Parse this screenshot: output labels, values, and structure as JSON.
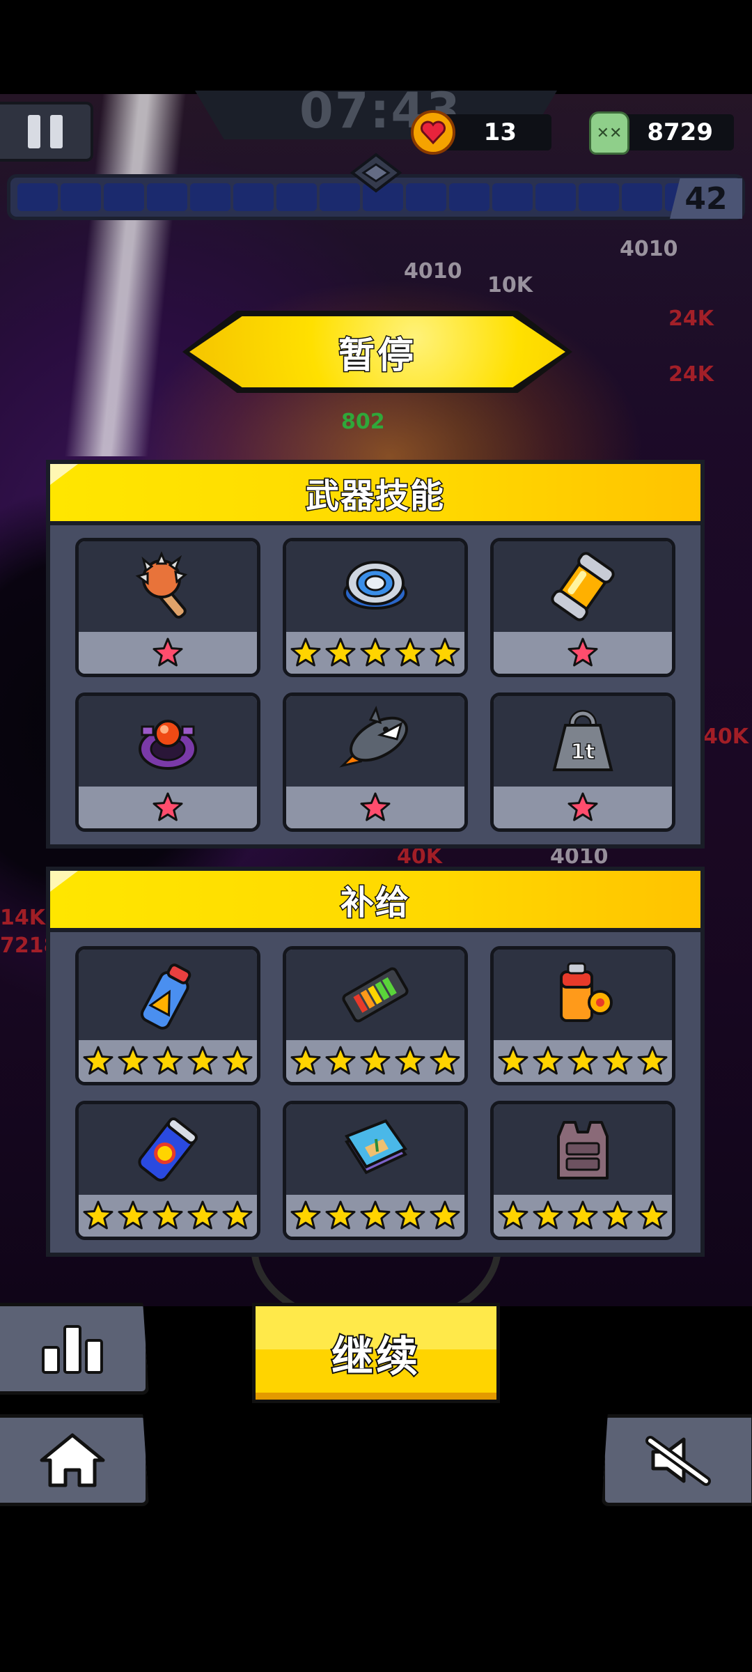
{
  "hud": {
    "timer": "07:43",
    "hearts": "13",
    "kills": "8729",
    "level": "42"
  },
  "pause_title": "暂停",
  "weapons_panel": {
    "title": "武器技能",
    "items": [
      {
        "icon": "spiked-club-icon",
        "stars": 1,
        "star_color": "#ff4d6d"
      },
      {
        "icon": "disc-drone-icon",
        "stars": 5,
        "star_color": "#ffd400"
      },
      {
        "icon": "energy-canister-icon",
        "stars": 1,
        "star_color": "#ff4d6d"
      },
      {
        "icon": "orb-turret-icon",
        "stars": 1,
        "star_color": "#ff4d6d"
      },
      {
        "icon": "shark-rocket-icon",
        "stars": 1,
        "star_color": "#ff4d6d"
      },
      {
        "icon": "one-ton-weight-icon",
        "stars": 1,
        "star_color": "#ff4d6d"
      }
    ],
    "weight_text": "1t"
  },
  "supplies_panel": {
    "title": "补给",
    "items": [
      {
        "icon": "spray-can-icon",
        "stars": 5,
        "star_color": "#ffd400"
      },
      {
        "icon": "battery-pack-icon",
        "stars": 5,
        "star_color": "#ffd400"
      },
      {
        "icon": "fuel-tank-icon",
        "stars": 5,
        "star_color": "#ffd400"
      },
      {
        "icon": "energy-drink-icon",
        "stars": 5,
        "star_color": "#ffd400"
      },
      {
        "icon": "map-book-icon",
        "stars": 5,
        "star_color": "#ffd400"
      },
      {
        "icon": "armor-vest-icon",
        "stars": 5,
        "star_color": "#ffd400"
      }
    ]
  },
  "continue_label": "继续",
  "buttons": {
    "stats": "bar-chart-icon",
    "home": "home-icon",
    "sound": "speaker-muted-icon"
  },
  "background_numbers": [
    "4010",
    "4010",
    "24K",
    "24K",
    "40K",
    "10K",
    "802",
    "7218",
    "14K",
    "40K",
    "4010"
  ],
  "colors": {
    "accent_yellow": "#ffd400",
    "panel_bg": "#474d63",
    "card_dark": "#2d3241",
    "xp_fill": "#1b2a6e"
  }
}
